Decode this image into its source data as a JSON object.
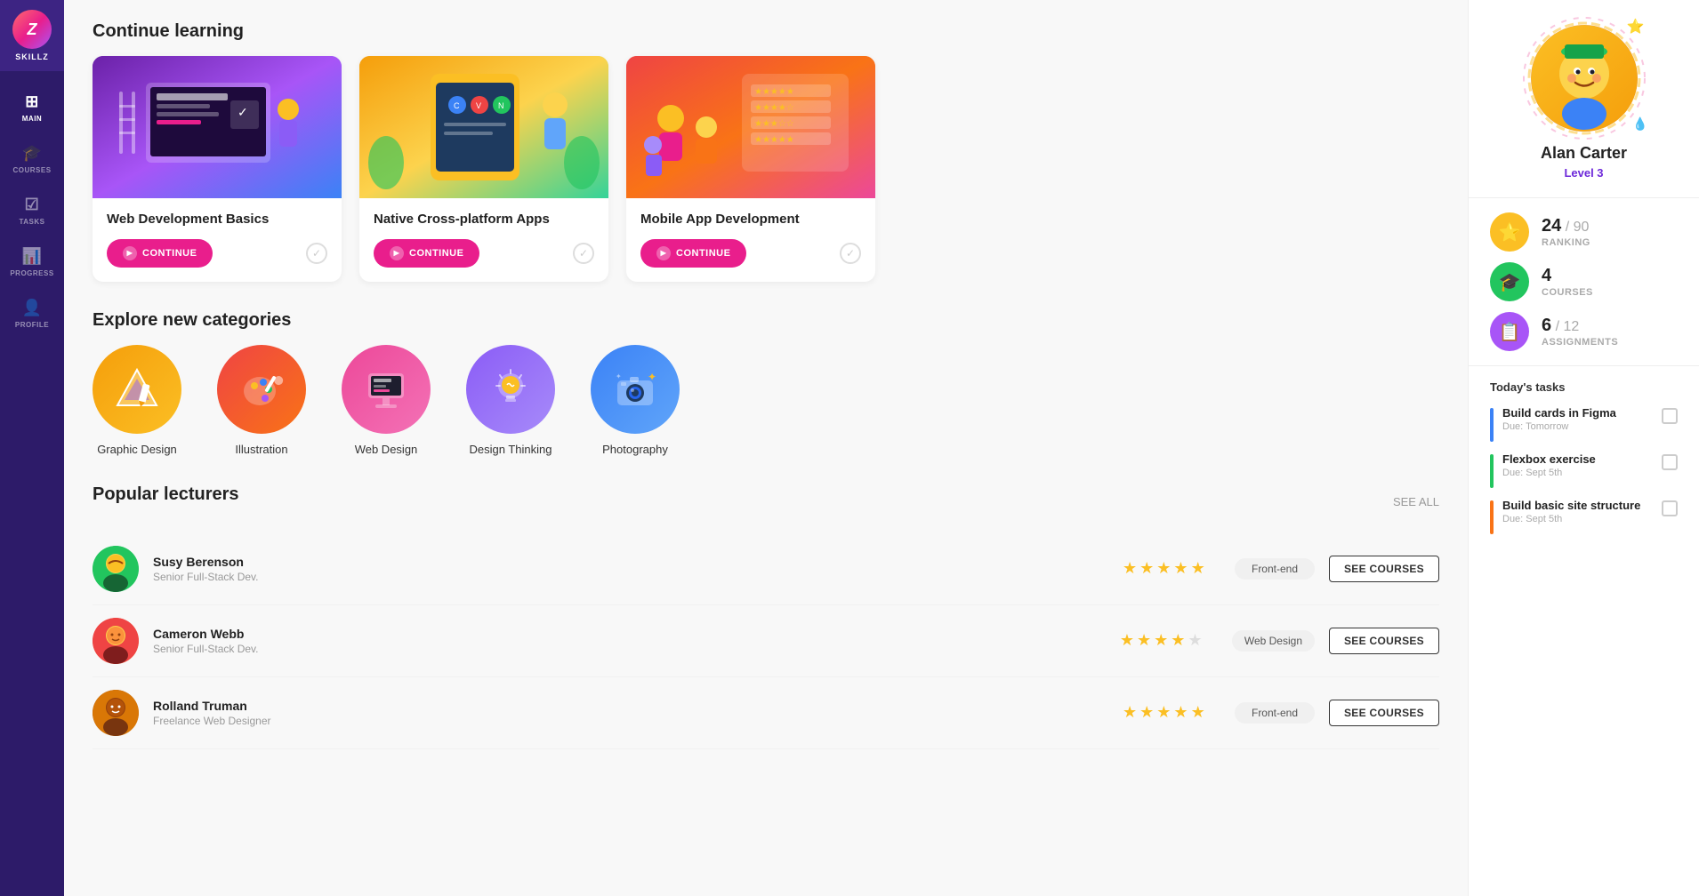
{
  "app": {
    "name": "SKILLZ",
    "logo_letter": "Z"
  },
  "sidebar": {
    "items": [
      {
        "id": "main",
        "label": "MAIN",
        "icon": "⊞",
        "active": true
      },
      {
        "id": "courses",
        "label": "COURSES",
        "icon": "🎓",
        "active": false
      },
      {
        "id": "tasks",
        "label": "TASKS",
        "icon": "✓",
        "active": false
      },
      {
        "id": "progress",
        "label": "PROGRESS",
        "icon": "📊",
        "active": false
      },
      {
        "id": "profile",
        "label": "PROFILE",
        "icon": "👤",
        "active": false
      }
    ]
  },
  "continue_learning": {
    "title": "Continue learning",
    "courses": [
      {
        "id": "web-dev",
        "title": "Web Development Basics",
        "btn_label": "CONTINUE",
        "color": "card-img-1"
      },
      {
        "id": "native",
        "title": "Native Cross-platform Apps",
        "btn_label": "CONTINUE",
        "color": "card-img-2"
      },
      {
        "id": "mobile",
        "title": "Mobile App Development",
        "btn_label": "CONTINUE",
        "color": "card-img-3"
      }
    ]
  },
  "categories": {
    "title": "Explore new categories",
    "items": [
      {
        "id": "graphic-design",
        "label": "Graphic Design",
        "icon": "🎨",
        "color": "cat-1"
      },
      {
        "id": "illustration",
        "label": "Illustration",
        "icon": "✏️",
        "color": "cat-2"
      },
      {
        "id": "web-design",
        "label": "Web Design",
        "icon": "🖥️",
        "color": "cat-3"
      },
      {
        "id": "design-thinking",
        "label": "Design Thinking",
        "icon": "💡",
        "color": "cat-4"
      },
      {
        "id": "photography",
        "label": "Photography",
        "icon": "📷",
        "color": "cat-5"
      }
    ]
  },
  "popular_lecturers": {
    "title": "Popular lecturers",
    "see_all_label": "SEE ALL",
    "lecturers": [
      {
        "id": "susy",
        "name": "Susy Berenson",
        "role": "Senior Full-Stack Dev.",
        "rating": 5,
        "tag": "Front-end",
        "btn_label": "SEE COURSES",
        "avatar": "av-1"
      },
      {
        "id": "cameron",
        "name": "Cameron Webb",
        "role": "Senior Full-Stack Dev.",
        "rating": 4,
        "tag": "Web Design",
        "btn_label": "SEE COURSES",
        "avatar": "av-2"
      },
      {
        "id": "rolland",
        "name": "Rolland Truman",
        "role": "Freelance Web Designer",
        "rating": 5,
        "tag": "Front-end",
        "btn_label": "SEE COURSES",
        "avatar": "av-3"
      }
    ]
  },
  "profile": {
    "name": "Alan Carter",
    "level": "Level 3",
    "ranking": {
      "value": "24",
      "max": "90",
      "label": "RANKING"
    },
    "courses": {
      "value": "4",
      "label": "COURSES"
    },
    "assignments": {
      "value": "6",
      "max": "12",
      "label": "ASSIGNMENTS"
    }
  },
  "tasks": {
    "header": "Today's tasks",
    "items": [
      {
        "id": "task-1",
        "title": "Build cards in Figma",
        "due": "Due: Tomorrow",
        "bar": "task-bar-blue"
      },
      {
        "id": "task-2",
        "title": "Flexbox exercise",
        "due": "Due: Sept 5th",
        "bar": "task-bar-green"
      },
      {
        "id": "task-3",
        "title": "Build basic site structure",
        "due": "Due: Sept 5th",
        "bar": "task-bar-orange"
      }
    ]
  }
}
